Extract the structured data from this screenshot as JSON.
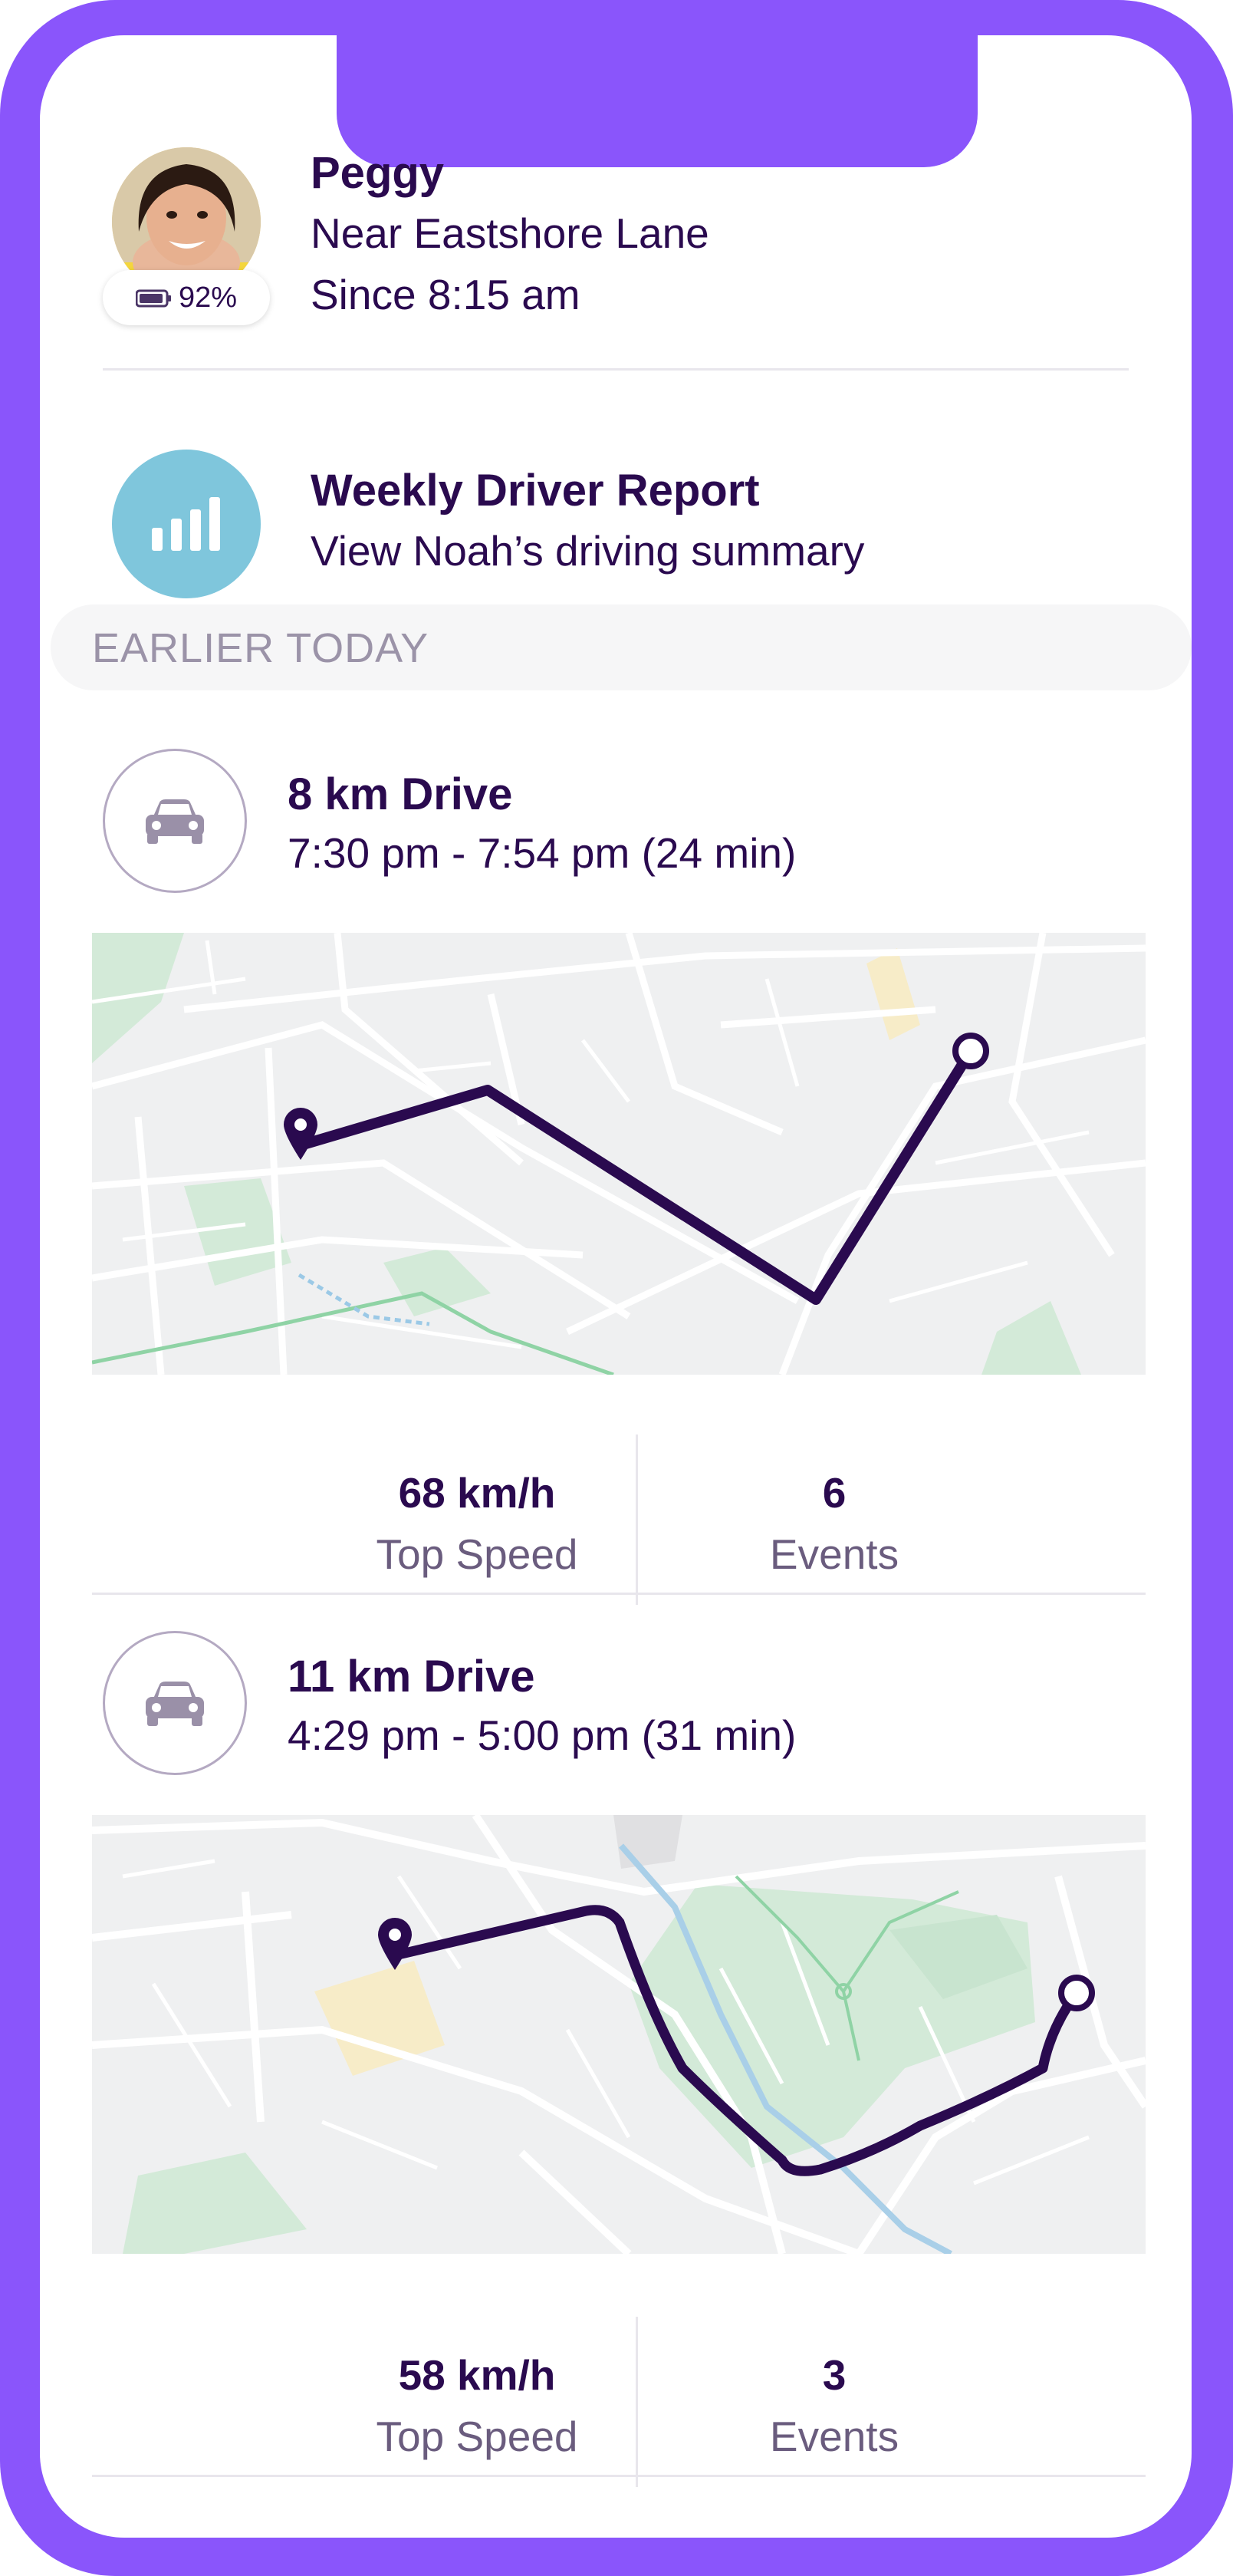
{
  "profile": {
    "name": "Peggy",
    "location": "Near Eastshore Lane",
    "since": "Since 8:15 am",
    "battery": "92%"
  },
  "report": {
    "title": "Weekly Driver Report",
    "subtitle": "View Noah’s driving summary"
  },
  "section_header": "EARLIER TODAY",
  "drives": [
    {
      "title": "8 km Drive",
      "time": "7:30 pm - 7:54 pm (24 min)",
      "top_speed": "68 km/h",
      "top_speed_label": "Top Speed",
      "events": "6",
      "events_label": "Events"
    },
    {
      "title": "11 km  Drive",
      "time": "4:29 pm - 5:00 pm (31 min)",
      "top_speed": "58 km/h",
      "top_speed_label": "Top Speed",
      "events": "3",
      "events_label": "Events"
    }
  ],
  "colors": {
    "frame": "#8a55fb",
    "text_primary": "#2a0a4f",
    "route": "#2a0a4f",
    "report_icon_bg": "#7fc6dc",
    "map_bg": "#eff0f1",
    "park": "#d3ead8"
  },
  "icons": [
    "battery-icon",
    "bar-chart-icon",
    "car-icon",
    "start-pin-icon",
    "end-point-icon"
  ]
}
